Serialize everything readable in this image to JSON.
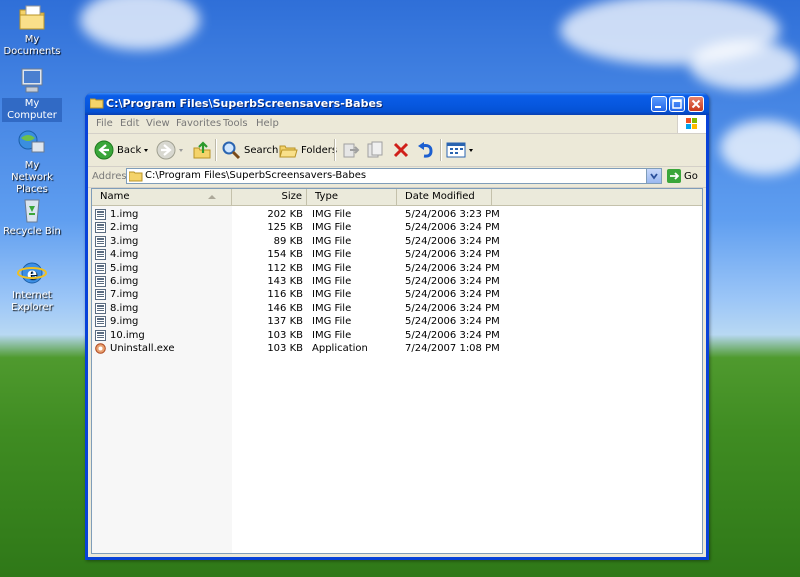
{
  "desktop": {
    "icons": [
      {
        "label": "My Documents"
      },
      {
        "label": "My Computer"
      },
      {
        "label": "My Network Places"
      },
      {
        "label": "Recycle Bin"
      },
      {
        "label": "Internet Explorer"
      }
    ]
  },
  "window": {
    "title": "C:\\Program Files\\SuperbScreensavers-Babes",
    "menu": [
      "File",
      "Edit",
      "View",
      "Favorites",
      "Tools",
      "Help"
    ],
    "toolbar": {
      "back_label": "Back",
      "search_label": "Search",
      "folders_label": "Folders"
    },
    "address": {
      "label": "Address",
      "value": "C:\\Program Files\\SuperbScreensavers-Babes",
      "go_label": "Go"
    },
    "columns": {
      "name": "Name",
      "size": "Size",
      "type": "Type",
      "date": "Date Modified"
    },
    "files": [
      {
        "name": "1.img",
        "size": "202 KB",
        "type": "IMG File",
        "date": "5/24/2006 3:23 PM"
      },
      {
        "name": "2.img",
        "size": "125 KB",
        "type": "IMG File",
        "date": "5/24/2006 3:24 PM"
      },
      {
        "name": "3.img",
        "size": "89 KB",
        "type": "IMG File",
        "date": "5/24/2006 3:24 PM"
      },
      {
        "name": "4.img",
        "size": "154 KB",
        "type": "IMG File",
        "date": "5/24/2006 3:24 PM"
      },
      {
        "name": "5.img",
        "size": "112 KB",
        "type": "IMG File",
        "date": "5/24/2006 3:24 PM"
      },
      {
        "name": "6.img",
        "size": "143 KB",
        "type": "IMG File",
        "date": "5/24/2006 3:24 PM"
      },
      {
        "name": "7.img",
        "size": "116 KB",
        "type": "IMG File",
        "date": "5/24/2006 3:24 PM"
      },
      {
        "name": "8.img",
        "size": "146 KB",
        "type": "IMG File",
        "date": "5/24/2006 3:24 PM"
      },
      {
        "name": "9.img",
        "size": "137 KB",
        "type": "IMG File",
        "date": "5/24/2006 3:24 PM"
      },
      {
        "name": "10.img",
        "size": "103 KB",
        "type": "IMG File",
        "date": "5/24/2006 3:24 PM"
      },
      {
        "name": "Uninstall.exe",
        "size": "103 KB",
        "type": "Application",
        "date": "7/24/2007 1:08 PM"
      }
    ]
  },
  "colors": {
    "title_bar": "#0a5ce8",
    "window_frame": "#0842d8",
    "selection": "#316ac5"
  }
}
